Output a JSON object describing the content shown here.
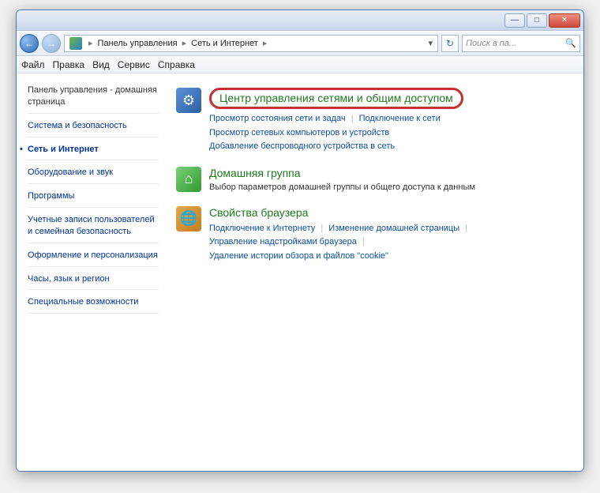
{
  "window_controls": {
    "min": "—",
    "max": "□",
    "close": "✕"
  },
  "breadcrumb": {
    "root": "Панель управления",
    "leaf": "Сеть и Интернет"
  },
  "search": {
    "placeholder": "Поиск в па..."
  },
  "menubar": [
    "Файл",
    "Правка",
    "Вид",
    "Сервис",
    "Справка"
  ],
  "sidebar": {
    "items": [
      {
        "label": "Панель управления - домашняя страница",
        "head": true
      },
      {
        "label": "Система и безопасность"
      },
      {
        "label": "Сеть и Интернет",
        "active": true
      },
      {
        "label": "Оборудование и звук"
      },
      {
        "label": "Программы"
      },
      {
        "label": "Учетные записи пользователей и семейная безопасность"
      },
      {
        "label": "Оформление и персонализация"
      },
      {
        "label": "Часы, язык и регион"
      },
      {
        "label": "Специальные возможности"
      }
    ]
  },
  "content": {
    "network": {
      "title": "Центр управления сетями и общим доступом",
      "links": [
        "Просмотр состояния сети и задач",
        "Подключение к сети",
        "Просмотр сетевых компьютеров и устройств",
        "Добавление беспроводного устройства в сеть"
      ]
    },
    "homegroup": {
      "title": "Домашняя группа",
      "desc": "Выбор параметров домашней группы и общего доступа к данным"
    },
    "browser": {
      "title": "Свойства браузера",
      "links": [
        "Подключение к Интернету",
        "Изменение домашней страницы",
        "Управление надстройками браузера",
        "Удаление истории обзора и файлов \"cookie\""
      ]
    }
  }
}
